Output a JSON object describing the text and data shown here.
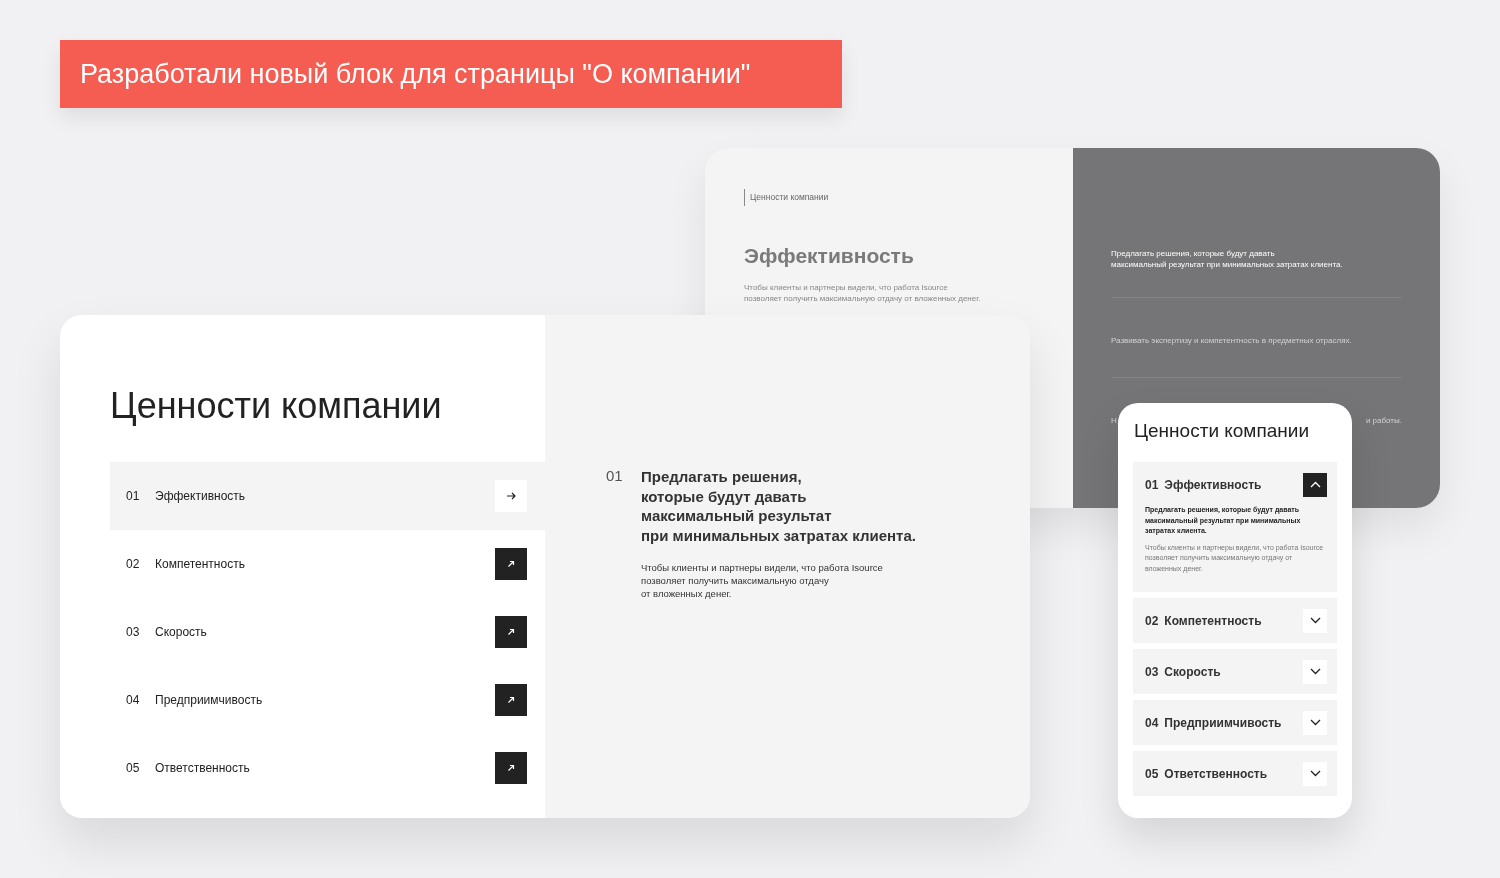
{
  "banner": {
    "text": "Разработали новый блок для страницы \"О компании\""
  },
  "back_card": {
    "breadcrumb": "Ценности компании",
    "title": "Эффективность",
    "description": "Чтобы клиенты и партнеры видели, что работа Isource\nпозволяет получить максимальную отдачу от вложенных денег.",
    "items": [
      {
        "text": "Предлагать решения, которые будут давать\nмаксимальный результат при минимальных затратах клиента.",
        "selected": true
      },
      {
        "text": "Развивать экспертизу и компетентность в предметных отраслях.",
        "selected": false
      }
    ],
    "partial_item": {
      "start": "Н",
      "end": "и работы."
    }
  },
  "main_card": {
    "title": "Ценности компании",
    "items": [
      {
        "number": "01",
        "label": "Эффективность",
        "selected": true
      },
      {
        "number": "02",
        "label": "Компетентность",
        "selected": false
      },
      {
        "number": "03",
        "label": "Скорость",
        "selected": false
      },
      {
        "number": "04",
        "label": "Предприимчивость",
        "selected": false
      },
      {
        "number": "05",
        "label": "Ответственность",
        "selected": false
      }
    ],
    "detail": {
      "number": "01",
      "heading": "Предлагать решения,\nкоторые будут давать\nмаксимальный результат\nпри минимальных затратах клиента.",
      "description": "Чтобы клиенты и партнеры видели, что работа Isource\nпозволяет получить максимальную отдачу\nот вложенных денег."
    }
  },
  "mobile_card": {
    "title": "Ценности компании",
    "items": [
      {
        "number": "01",
        "label": "Эффективность",
        "expanded": true,
        "heading": "Предлагать решения, которые будут давать максимальный результат при минимальных затратах клиента.",
        "description": "Чтобы клиенты и партнеры видели, что работа Isource позволяет получить максимальную отдачу от вложенных денег."
      },
      {
        "number": "02",
        "label": "Компетентность",
        "expanded": false
      },
      {
        "number": "03",
        "label": "Скорость",
        "expanded": false
      },
      {
        "number": "04",
        "label": "Предприимчивость",
        "expanded": false
      },
      {
        "number": "05",
        "label": "Ответственность",
        "expanded": false
      }
    ]
  }
}
